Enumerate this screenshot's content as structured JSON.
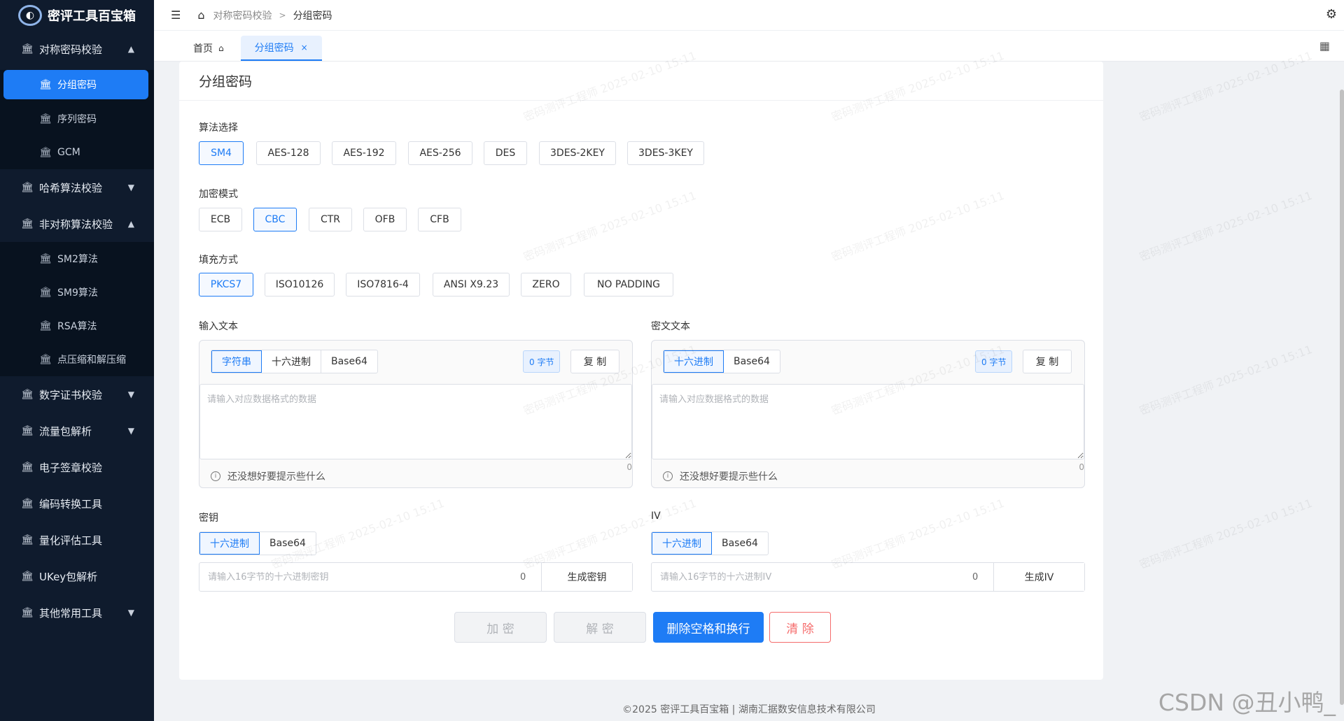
{
  "app": {
    "title": "密评工具百宝箱",
    "logo_glyph": "◐"
  },
  "sidebar": {
    "groups": [
      {
        "label": "对称密码校验",
        "expanded": true,
        "items": [
          {
            "label": "分组密码",
            "active": true
          },
          {
            "label": "序列密码"
          },
          {
            "label": "GCM"
          }
        ]
      },
      {
        "label": "哈希算法校验",
        "expanded": false
      },
      {
        "label": "非对称算法校验",
        "expanded": true,
        "items": [
          {
            "label": "SM2算法"
          },
          {
            "label": "SM9算法"
          },
          {
            "label": "RSA算法"
          },
          {
            "label": "点压缩和解压缩"
          }
        ]
      },
      {
        "label": "数字证书校验",
        "expanded": false
      },
      {
        "label": "流量包解析",
        "expanded": false
      },
      {
        "label": "电子签章校验"
      },
      {
        "label": "编码转换工具"
      },
      {
        "label": "量化评估工具"
      },
      {
        "label": "UKey包解析"
      },
      {
        "label": "其他常用工具",
        "expanded": false
      }
    ]
  },
  "breadcrumb": {
    "parent": "对称密码校验",
    "separator": ">",
    "current": "分组密码"
  },
  "tabs": [
    {
      "label": "首页"
    },
    {
      "label": "分组密码",
      "close": "×"
    }
  ],
  "card": {
    "title": "分组密码"
  },
  "algorithm": {
    "label": "算法选择",
    "options": [
      "SM4",
      "AES-128",
      "AES-192",
      "AES-256",
      "DES",
      "3DES-2KEY",
      "3DES-3KEY"
    ],
    "selected": "SM4"
  },
  "mode": {
    "label": "加密模式",
    "options": [
      "ECB",
      "CBC",
      "CTR",
      "OFB",
      "CFB"
    ],
    "selected": "CBC"
  },
  "padding": {
    "label": "填充方式",
    "options": [
      "PKCS7",
      "ISO10126",
      "ISO7816-4",
      "ANSI X9.23",
      "ZERO",
      "NO PADDING"
    ],
    "selected": "PKCS7"
  },
  "input_text": {
    "label": "输入文本",
    "formats": [
      "字符串",
      "十六进制",
      "Base64"
    ],
    "selected": "字符串",
    "bytes": "0 字节",
    "copy": "复 制",
    "placeholder": "请输入对应数据格式的数据",
    "counter": "0",
    "hint": "还没想好要提示些什么"
  },
  "cipher_text": {
    "label": "密文文本",
    "formats": [
      "十六进制",
      "Base64"
    ],
    "selected": "十六进制",
    "bytes": "0 字节",
    "copy": "复 制",
    "placeholder": "请输入对应数据格式的数据",
    "counter": "0",
    "hint": "还没想好要提示些什么"
  },
  "key": {
    "label": "密钥",
    "formats": [
      "十六进制",
      "Base64"
    ],
    "selected": "十六进制",
    "placeholder": "请输入16字节的十六进制密钥",
    "count": "0",
    "generate": "生成密钥"
  },
  "iv": {
    "label": "IV",
    "formats": [
      "十六进制",
      "Base64"
    ],
    "selected": "十六进制",
    "placeholder": "请输入16字节的十六进制IV",
    "count": "0",
    "generate": "生成IV"
  },
  "actions": {
    "encrypt": "加 密",
    "decrypt": "解 密",
    "strip": "删除空格和换行",
    "clear": "清 除"
  },
  "footer": "©2025 密评工具百宝箱 | 湖南汇据数安信息技术有限公司",
  "watermark": "密码测评工程师 2025-02-10 15:11",
  "brand_watermark": "CSDN @丑小鸭_",
  "colors": {
    "primary": "#1e7cf5",
    "danger": "#f56c6c",
    "sidebar": "#0f1b2d"
  }
}
